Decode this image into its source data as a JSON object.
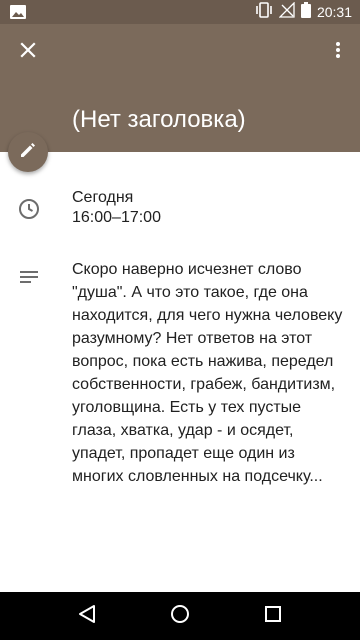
{
  "status_bar": {
    "time": "20:31",
    "icons": [
      "image-icon",
      "vibrate-icon",
      "no-signal-icon",
      "battery-icon"
    ]
  },
  "app_bar": {
    "title": "(Нет заголовка)",
    "close_icon": "close-icon",
    "more_icon": "more-vert-icon",
    "edit_icon": "pencil-icon",
    "color": "#7b6a5b"
  },
  "event": {
    "date": "Сегодня",
    "time_range": "16:00–17:00",
    "description": "Скоро наверно исчезнет слово \"душа\". А что это такое, где она находится, для чего нужна человеку разумному? Нет ответов на этот вопрос, пока есть нажива, передел собственности, грабеж, бандитизм, уголовщина. Есть у тех пустые глаза, хватка, удар - и осядет, упадет, пропадет еще один из многих словленных на подсечку..."
  },
  "nav_bar": {
    "buttons": [
      "back-icon",
      "home-icon",
      "recents-icon"
    ]
  }
}
